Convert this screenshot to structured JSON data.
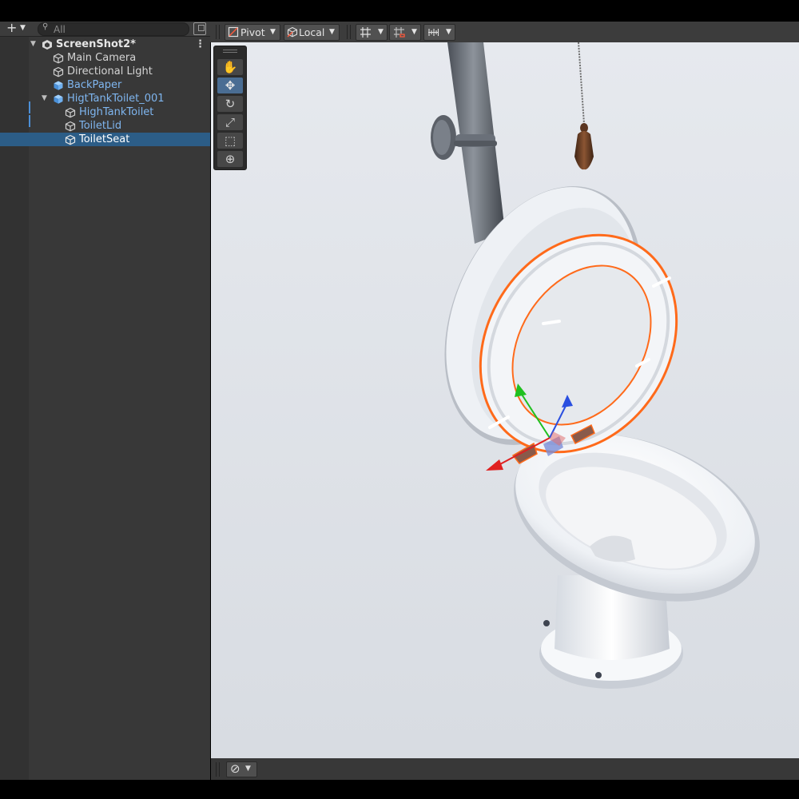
{
  "hierarchy": {
    "add_label": "+",
    "search_placeholder": "All",
    "items": [
      {
        "label": "ScreenShot2*",
        "kind": "scene",
        "depth": 0,
        "expanded": true
      },
      {
        "label": "Main Camera",
        "kind": "object",
        "depth": 1
      },
      {
        "label": "Directional Light",
        "kind": "object",
        "depth": 1
      },
      {
        "label": "BackPaper",
        "kind": "prefab",
        "depth": 1
      },
      {
        "label": "HigtTankToilet_001",
        "kind": "prefab",
        "depth": 1,
        "expanded": true
      },
      {
        "label": "HighTankToilet",
        "kind": "object",
        "depth": 2
      },
      {
        "label": "ToiletLid",
        "kind": "object",
        "depth": 2
      },
      {
        "label": "ToiletSeat",
        "kind": "object",
        "depth": 2,
        "selected": true
      }
    ]
  },
  "scene_toolbar": {
    "pivot_label": "Pivot",
    "local_label": "Local"
  },
  "tools": [
    {
      "name": "hand-tool",
      "icon": "hand-icon"
    },
    {
      "name": "move-tool",
      "icon": "move-icon",
      "active": true
    },
    {
      "name": "rotate-tool",
      "icon": "rotate-icon"
    },
    {
      "name": "scale-tool",
      "icon": "scale-icon"
    },
    {
      "name": "rect-tool",
      "icon": "rect-icon"
    },
    {
      "name": "transform-tool",
      "icon": "transform-icon"
    }
  ],
  "colors": {
    "panel": "#383838",
    "selection": "#2c5d87",
    "prefab_text": "#7fb6f0",
    "scene_background": "#dfe3e9",
    "selection_outline": "#ff6a1a",
    "gizmo_x": "#e02020",
    "gizmo_y": "#1fc01f",
    "gizmo_z": "#2a4fe0"
  }
}
